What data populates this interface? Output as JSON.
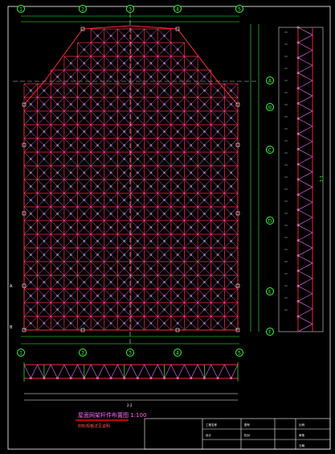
{
  "drawing": {
    "title": "屋面网架杆件布置图 1:100",
    "subtitle": "材料规格详见说明",
    "top_axes": [
      "1",
      "2",
      "3",
      "4",
      "5"
    ],
    "bottom_axes": [
      "1",
      "2",
      "3",
      "4",
      "5"
    ],
    "right_axes": [
      "A",
      "B",
      "C",
      "D",
      "E",
      "F"
    ],
    "left_labels": [
      "A",
      "B"
    ],
    "section_label": "1-1",
    "elevation_label": "2-2"
  },
  "title_block": {
    "rows": [
      [
        "工程名称",
        "",
        "图号",
        "",
        "比例",
        ""
      ],
      [
        "设计",
        "",
        "校对",
        "",
        "审核",
        ""
      ],
      [
        "",
        "",
        "",
        "",
        "日期",
        ""
      ]
    ]
  },
  "colors": {
    "background": "#000000",
    "frame": "#ffffff",
    "lower_chord": "#ff2a3a",
    "upper_chord": "#ff44ff",
    "web": "#ff66ff",
    "dimension": "#30ff30",
    "axis_bubble": "#30ff30",
    "centerline": "#ffffff",
    "node": "#ffffff",
    "title_underline": "#ff0000"
  }
}
